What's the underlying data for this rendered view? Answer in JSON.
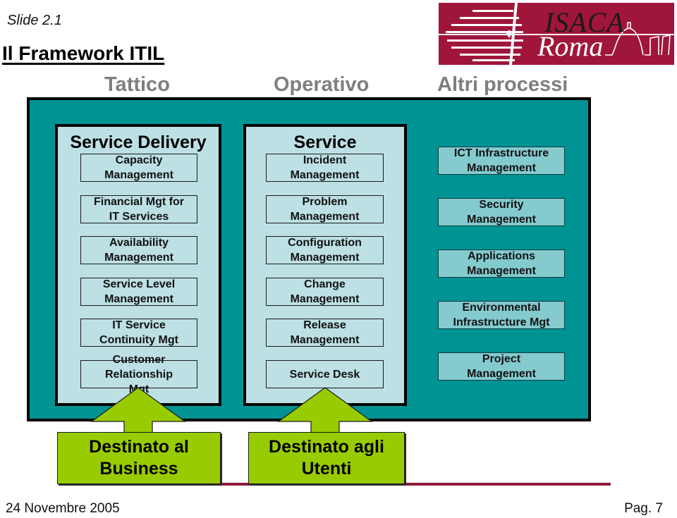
{
  "slide": {
    "label": "Slide 2.1",
    "title": "Il Framework ITIL"
  },
  "logo": {
    "line1": "ISACA",
    "line2": "Roma",
    "brand_color": "#a0163a"
  },
  "columns": {
    "tactical": "Tattico",
    "operational": "Operativo",
    "other": "Altri processi"
  },
  "service_delivery": {
    "title": "Service Delivery",
    "items": [
      {
        "line1": "Capacity",
        "line2": "Management"
      },
      {
        "line1": "Financial Mgt for",
        "line2": "IT Services"
      },
      {
        "line1": "Availability",
        "line2": "Management"
      },
      {
        "line1": "Service Level",
        "line2": "Management"
      },
      {
        "line1": "IT Service",
        "line2": "Continuity Mgt"
      },
      {
        "line1": "Customer",
        "line2": "Relationship",
        "line3": "Mgt"
      }
    ]
  },
  "service_support": {
    "title": "Service",
    "items": [
      {
        "line1": "Incident",
        "line2": "Management"
      },
      {
        "line1": "Problem",
        "line2": "Management"
      },
      {
        "line1": "Configuration",
        "line2": "Management"
      },
      {
        "line1": "Change",
        "line2": "Management"
      },
      {
        "line1": "Release",
        "line2": "Management"
      },
      {
        "line1": "Service Desk"
      }
    ]
  },
  "other_processes": {
    "items": [
      {
        "line1": "ICT Infrastructure",
        "line2": "Management"
      },
      {
        "line1": "Security",
        "line2": "Management"
      },
      {
        "line1": "Applications",
        "line2": "Management"
      },
      {
        "line1": "Environmental",
        "line2": "Infrastructure Mgt"
      },
      {
        "line1": "Project",
        "line2": "Management"
      }
    ]
  },
  "destinations": {
    "business": {
      "line1": "Destinato al",
      "line2": "Business"
    },
    "users": {
      "line1": "Destinato agli",
      "line2": "Utenti"
    }
  },
  "colors": {
    "frame_teal": "#009393",
    "panel_light": "#bde0e4",
    "arrow_green": "#99cc00",
    "footer_line": "#8b1a3a"
  },
  "footer": {
    "date": "24 Novembre 2005",
    "page": "Pag. 7"
  }
}
